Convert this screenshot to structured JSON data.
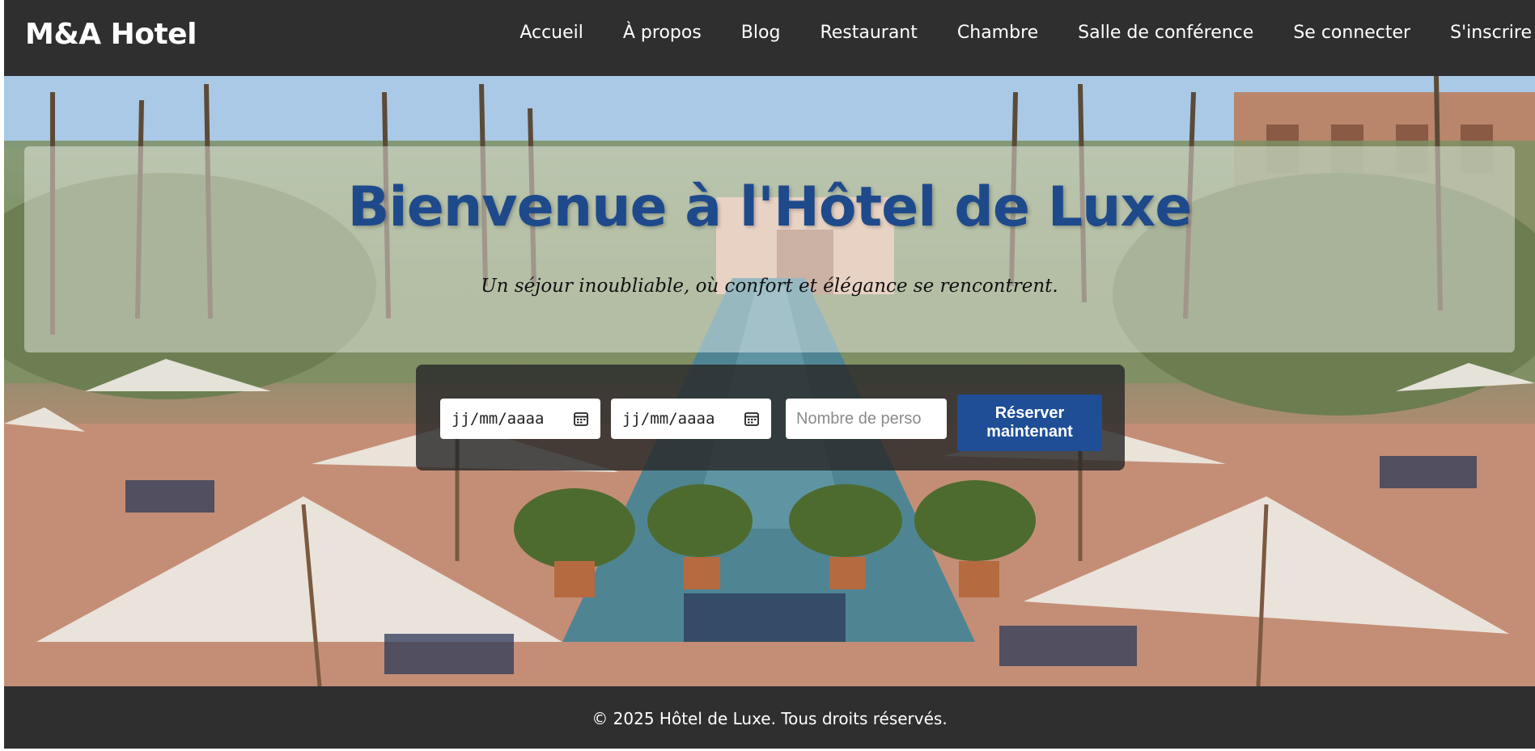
{
  "header": {
    "brand": "M&A Hotel",
    "nav": [
      "Accueil",
      "À propos",
      "Blog",
      "Restaurant",
      "Chambre",
      "Salle de conférence",
      "Se connecter",
      "S'inscrire"
    ]
  },
  "hero": {
    "title": "Bienvenue à l'Hôtel de Luxe",
    "subtitle": "Un séjour inoubliable, où confort et élégance se rencontrent.",
    "background_description_icon": "hotel-pool-photo"
  },
  "booking": {
    "checkin_value": "jj/mm/aaaa",
    "checkout_value": "jj/mm/aaaa",
    "guests_placeholder": "Nombre de perso",
    "reserve_line1": "Réserver",
    "reserve_line2": "maintenant",
    "calendar_icon": "calendar-icon"
  },
  "footer": {
    "text": "© 2025 Hôtel de Luxe. Tous droits réservés."
  },
  "colors": {
    "header_bg": "#2f2f2f",
    "title_blue": "#1e4a8c",
    "button_blue": "#1f4e96"
  }
}
